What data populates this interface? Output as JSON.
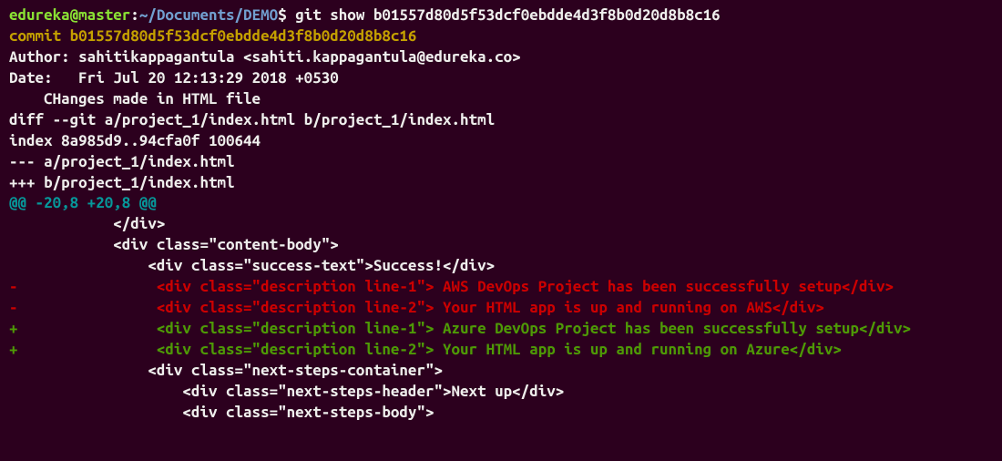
{
  "prompt": {
    "user_host": "edureka@master",
    "colon": ":",
    "path": "~/Documents/DEMO",
    "dollar": "$ ",
    "command": "git show b01557d80d5f53dcf0ebdde4d3f8b0d20d8b8c16"
  },
  "commit_line": "commit b01557d80d5f53dcf0ebdde4d3f8b0d20d8b8c16",
  "author_line": "Author: sahitikappagantula <sahiti.kappagantula@edureka.co>",
  "date_line": "Date:   Fri Jul 20 12:13:29 2018 +0530",
  "blank1": "",
  "message_line": "    CHanges made in HTML file",
  "blank2": "",
  "diff_cmd": "diff --git a/project_1/index.html b/project_1/index.html",
  "index_line": "index 8a985d9..94cfa0f 100644",
  "minus_file": "--- a/project_1/index.html",
  "plus_file": "+++ b/project_1/index.html",
  "hunk": "@@ -20,8 +20,8 @@",
  "ctx1": "            </div>",
  "ctx2": "            <div class=\"content-body\">",
  "ctx3": "                <div class=\"success-text\">Success!</div>",
  "del1": "-                <div class=\"description line-1\"> AWS DevOps Project has been successfully setup</div>",
  "del2": "-                <div class=\"description line-2\"> Your HTML app is up and running on AWS</div>",
  "add1": "+                <div class=\"description line-1\"> Azure DevOps Project has been successfully setup</div>",
  "add2": "+                <div class=\"description line-2\"> Your HTML app is up and running on Azure</div>",
  "ctx4": "                <div class=\"next-steps-container\">",
  "ctx5": "                    <div class=\"next-steps-header\">Next up</div>",
  "ctx6": "                    <div class=\"next-steps-body\">"
}
